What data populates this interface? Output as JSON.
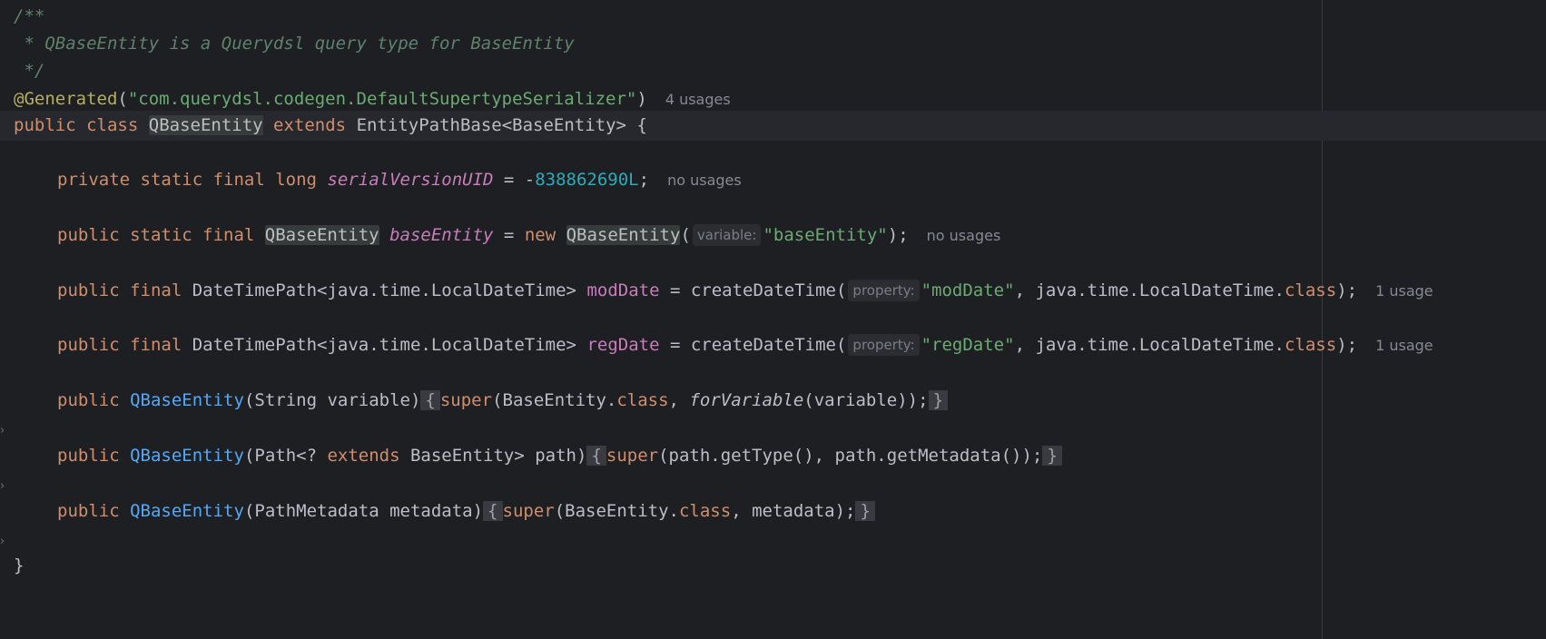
{
  "editor": {
    "doc_comment": {
      "open": "/**",
      "body": " * QBaseEntity is a Querydsl query type for BaseEntity",
      "close": " */"
    },
    "annotation": {
      "name": "@Generated",
      "open_paren": "(",
      "value": "\"com.querydsl.codegen.DefaultSupertypeSerializer\"",
      "close_paren": ")",
      "usages": "4 usages"
    },
    "class_decl": {
      "kw_public": "public",
      "kw_class": "class",
      "class_name": "QBaseEntity",
      "kw_extends": "extends",
      "super_type": "EntityPathBase<BaseEntity>",
      "open_brace": " {"
    },
    "serial_field": {
      "modifiers": "private static final long",
      "name": "serialVersionUID",
      "eq": " = -",
      "value": "838862690L",
      "semi": ";",
      "usages": "no usages"
    },
    "base_entity_field": {
      "modifiers": "public static final",
      "type": "QBaseEntity",
      "name": "baseEntity",
      "eq": " = ",
      "kw_new": "new",
      "ctor": "QBaseEntity",
      "open": "(",
      "param_hint": "variable:",
      "arg": "\"baseEntity\"",
      "close": ");",
      "usages": "no usages"
    },
    "mod_date_field": {
      "modifiers": "public final",
      "type": "DateTimePath<java.time.LocalDateTime>",
      "name": "modDate",
      "call": " = createDateTime(",
      "param_hint": "property:",
      "arg": "\"modDate\"",
      "rest": ", java.time.LocalDateTime.",
      "kw_class": "class",
      "close": ");",
      "usages": "1 usage"
    },
    "reg_date_field": {
      "modifiers": "public final",
      "type": "DateTimePath<java.time.LocalDateTime>",
      "name": "regDate",
      "call": " = createDateTime(",
      "param_hint": "property:",
      "arg": "\"regDate\"",
      "rest": ", java.time.LocalDateTime.",
      "kw_class": "class",
      "close": ");",
      "usages": "1 usage"
    },
    "ctor1": {
      "kw_public": "public",
      "name": "QBaseEntity",
      "params": "(String variable)",
      "open_brace": "{",
      "kw_super": "super",
      "body_a": "(BaseEntity.",
      "kw_class": "class",
      "body_b": ", ",
      "static_call": "forVariable",
      "body_c": "(variable));",
      "close_brace": "}"
    },
    "ctor2": {
      "kw_public": "public",
      "name": "QBaseEntity",
      "params_a": "(Path<? ",
      "kw_extends": "extends",
      "params_b": " BaseEntity> path)",
      "open_brace": "{",
      "kw_super": "super",
      "body": "(path.getType(), path.getMetadata());",
      "close_brace": "}"
    },
    "ctor3": {
      "kw_public": "public",
      "name": "QBaseEntity",
      "params": "(PathMetadata metadata)",
      "open_brace": "{",
      "kw_super": "super",
      "body_a": "(BaseEntity.",
      "kw_class": "class",
      "body_b": ", metadata);",
      "close_brace": "}"
    },
    "class_close": "}",
    "colors": {
      "background": "#1e1f22",
      "keyword": "#cf8e6d",
      "string": "#6aab73",
      "number": "#2aacb8",
      "field": "#c77dbb",
      "constructor": "#56a8f5",
      "annotation": "#b3ae60",
      "doc_comment": "#5f826b"
    }
  }
}
